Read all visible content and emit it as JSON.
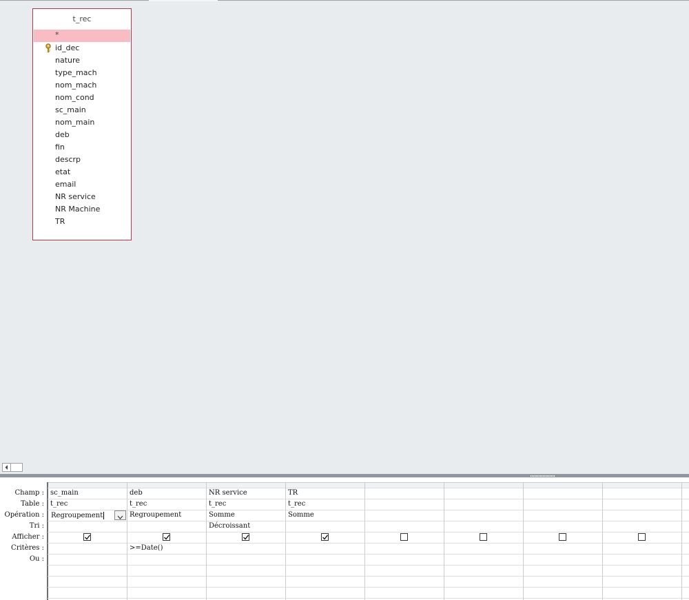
{
  "table": {
    "title": "t_rec",
    "fields": [
      "*",
      "id_dec",
      "nature",
      "type_mach",
      "nom_mach",
      "nom_cond",
      "sc_main",
      "nom_main",
      "deb",
      "fin",
      "descrp",
      "etat",
      "email",
      "NR service",
      "NR Machine",
      "TR"
    ],
    "primary_key": "id_dec",
    "key_icon": "key-icon"
  },
  "scroll": {
    "left_icon": "chevron-left-icon"
  },
  "grid": {
    "row_labels": [
      "Champ :",
      "Table :",
      "Opération :",
      "Tri :",
      "Afficher :",
      "Critères :",
      "Ou :"
    ],
    "columns": [
      {
        "champ": "sc_main",
        "table": "t_rec",
        "operation": "Regroupement",
        "tri": "",
        "afficher": true,
        "criteres": ""
      },
      {
        "champ": "deb",
        "table": "t_rec",
        "operation": "Regroupement",
        "tri": "",
        "afficher": true,
        "criteres": ">=Date()"
      },
      {
        "champ": "NR service",
        "table": "t_rec",
        "operation": "Somme",
        "tri": "Décroissant",
        "afficher": true,
        "criteres": ""
      },
      {
        "champ": "TR",
        "table": "t_rec",
        "operation": "Somme",
        "tri": "",
        "afficher": true,
        "criteres": ""
      },
      {
        "champ": "",
        "table": "",
        "operation": "",
        "tri": "",
        "afficher": false,
        "criteres": ""
      },
      {
        "champ": "",
        "table": "",
        "operation": "",
        "tri": "",
        "afficher": false,
        "criteres": ""
      },
      {
        "champ": "",
        "table": "",
        "operation": "",
        "tri": "",
        "afficher": false,
        "criteres": ""
      },
      {
        "champ": "",
        "table": "",
        "operation": "",
        "tri": "",
        "afficher": false,
        "criteres": ""
      }
    ],
    "active_cell": "operation of column 1",
    "dropdown_icon": "chevron-down-icon"
  },
  "colors": {
    "table_border": "#b03a48",
    "star_row": "#f9bcc2",
    "background": "#e9ecef"
  }
}
